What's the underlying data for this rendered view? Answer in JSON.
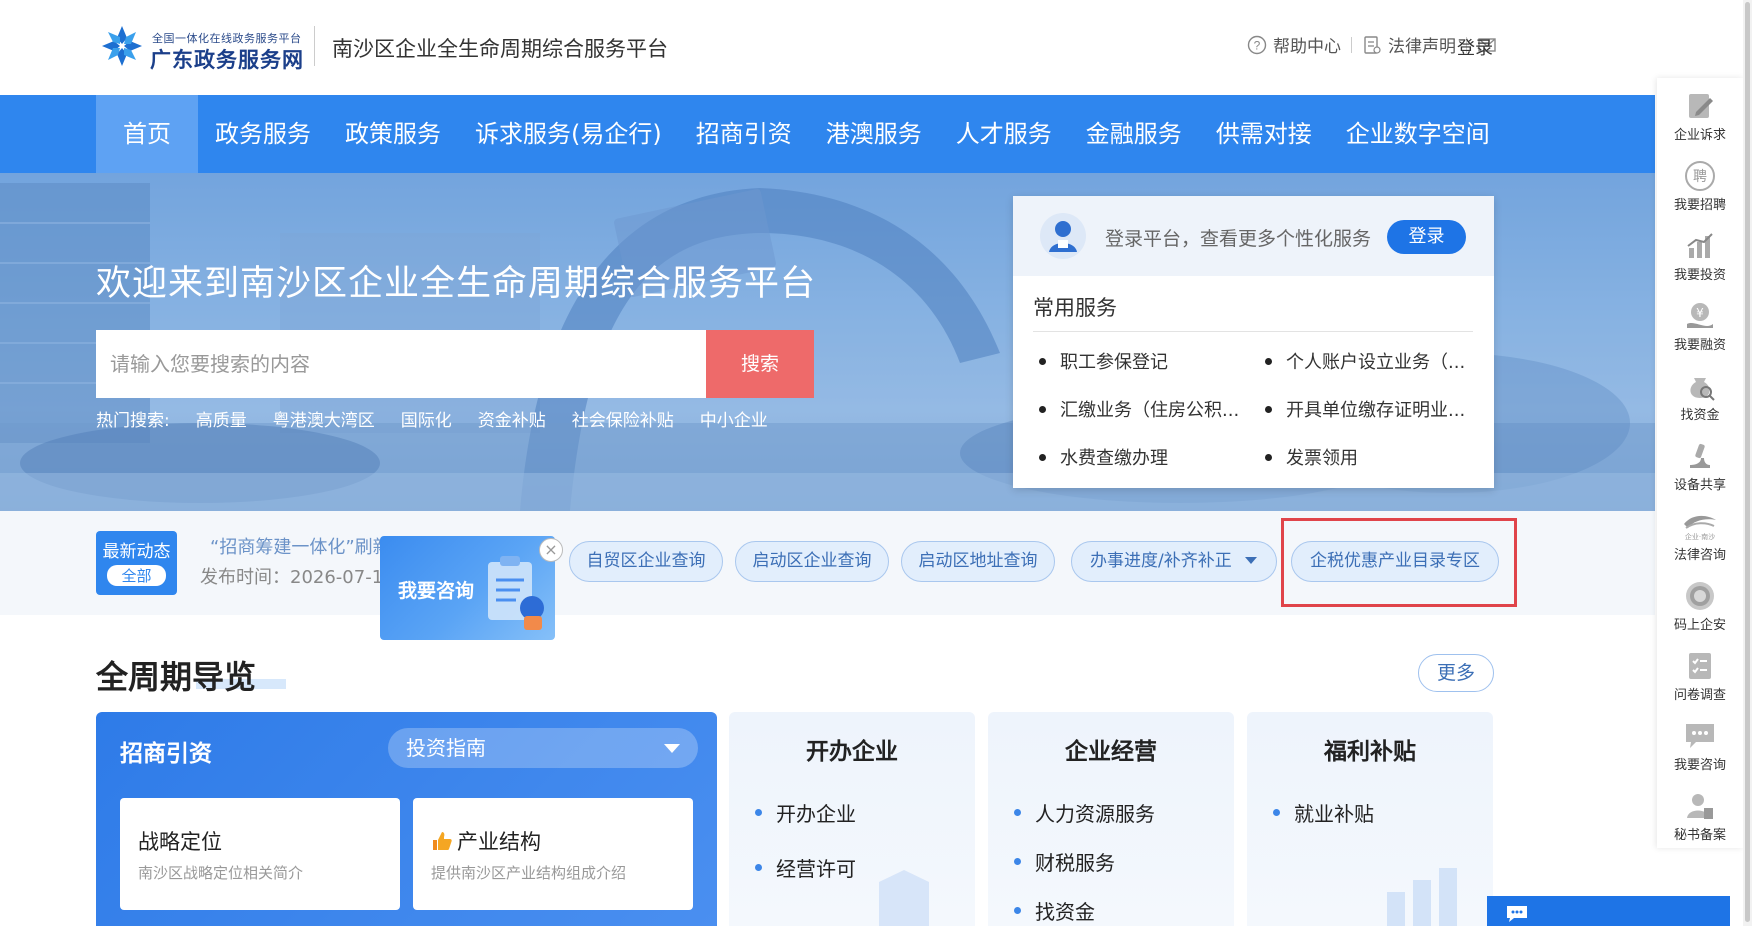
{
  "header": {
    "brand_small": "全国一体化在线政务服务平台",
    "brand_big": "广东政务服务网",
    "platform_name": "南沙区企业全生命周期综合服务平台",
    "help": "帮助中心",
    "legal": "法律声明",
    "login": "登录"
  },
  "nav": {
    "items": [
      "首页",
      "政务服务",
      "政策服务",
      "诉求服务(易企行)",
      "招商引资",
      "港澳服务",
      "人才服务",
      "金融服务",
      "供需对接",
      "企业数字空间"
    ],
    "active_index": 0
  },
  "banner": {
    "welcome": "欢迎来到南沙区企业全生命周期综合服务平台",
    "search_placeholder": "请输入您要搜索的内容",
    "search_button": "搜索",
    "hot_label": "热门搜索:",
    "hot_terms": [
      "高质量",
      "粤港澳大湾区",
      "国际化",
      "资金补贴",
      "社会保险补贴",
      "中小企业"
    ]
  },
  "login_card": {
    "tip": "登录平台，查看更多个性化服务",
    "login_button": "登录",
    "common_title": "常用服务",
    "services": [
      "职工参保登记",
      "个人账户设立业务（...",
      "汇缴业务（住房公积...",
      "开具单位缴存证明业...",
      "水费查缴办理",
      "发票领用"
    ]
  },
  "news": {
    "badge_line1": "最新动态",
    "badge_line2": "全部",
    "title": "“招商筹建一体化”刷新项目招引落地效",
    "time_label": "发布时间：2026-07-1",
    "consult_popup": "我要咨询",
    "consult_close": "×",
    "quick_links": [
      "自贸区企业查询",
      "启动区企业查询",
      "启动区地址查询",
      "办事进度/补齐补正",
      "企税优惠产业目录专区"
    ]
  },
  "section": {
    "title": "全周期导览",
    "more": "更多",
    "invest": {
      "title": "招商引资",
      "guide_select": "投资指南",
      "cards": [
        {
          "title": "战略定位",
          "desc": "南沙区战略定位相关简介"
        },
        {
          "title": "产业结构",
          "desc": "提供南沙区产业结构组成介绍"
        }
      ]
    },
    "columns": [
      {
        "title": "开办企业",
        "items": [
          "开办企业",
          "经营许可"
        ]
      },
      {
        "title": "企业经营",
        "items": [
          "人力资源服务",
          "财税服务",
          "找资金"
        ]
      },
      {
        "title": "福利补贴",
        "items": [
          "就业补贴"
        ]
      }
    ]
  },
  "sidebar": {
    "items": [
      "企业诉求",
      "我要招聘",
      "我要投资",
      "我要融资",
      "找资金",
      "设备共享",
      "法律咨询",
      "码上企安",
      "问卷调查",
      "我要咨询",
      "秘书备案"
    ],
    "law_logo_text": "企业·南沙"
  },
  "colors": {
    "nav_bg": "#2f86ee",
    "search_btn": "#ee6a6a",
    "highlight_border": "#e0444a",
    "primary": "#1e74e6"
  }
}
